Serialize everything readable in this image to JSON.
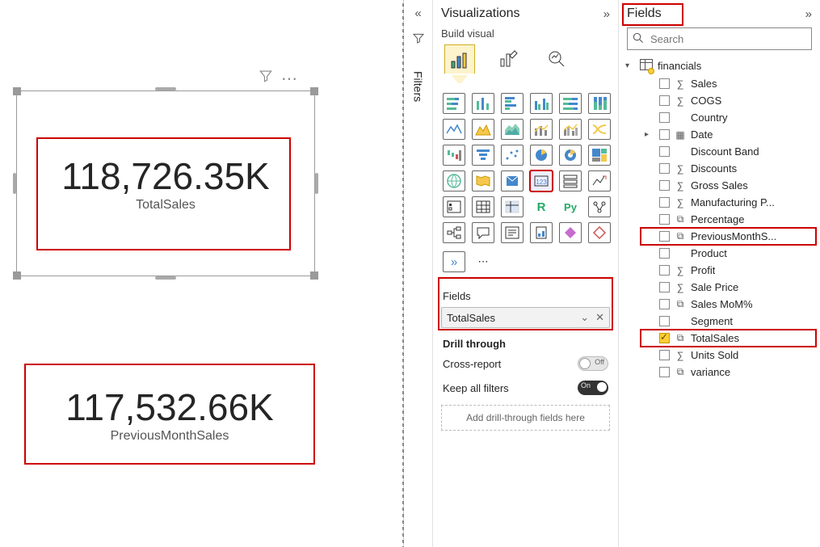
{
  "canvas": {
    "card1_value": "118,726.35K",
    "card1_label": "TotalSales",
    "card2_value": "117,532.66K",
    "card2_label": "PreviousMonthSales"
  },
  "filters_rail": {
    "title": "Filters"
  },
  "vis": {
    "title": "Visualizations",
    "build_label": "Build visual",
    "field_well_label": "Fields",
    "field_value": "TotalSales",
    "drill_title": "Drill through",
    "cross_report": "Cross-report",
    "cross_report_state": "Off",
    "keep_filters": "Keep all filters",
    "keep_filters_state": "On",
    "drill_placeholder": "Add drill-through fields here"
  },
  "fields": {
    "title": "Fields",
    "search_placeholder": "Search",
    "table": "financials",
    "items": [
      {
        "name": "Sales",
        "icon": "sum"
      },
      {
        "name": "COGS",
        "icon": "sum"
      },
      {
        "name": "Country",
        "icon": ""
      },
      {
        "name": "Date",
        "icon": "table",
        "expandable": true
      },
      {
        "name": "Discount Band",
        "icon": ""
      },
      {
        "name": "Discounts",
        "icon": "sum"
      },
      {
        "name": "Gross Sales",
        "icon": "sum"
      },
      {
        "name": "Manufacturing P...",
        "icon": "sum"
      },
      {
        "name": "Percentage",
        "icon": "calc"
      },
      {
        "name": "PreviousMonthS...",
        "icon": "calc",
        "highlight": true
      },
      {
        "name": "Product",
        "icon": ""
      },
      {
        "name": "Profit",
        "icon": "sum"
      },
      {
        "name": "Sale Price",
        "icon": "sum"
      },
      {
        "name": "Sales MoM%",
        "icon": "calc"
      },
      {
        "name": "Segment",
        "icon": ""
      },
      {
        "name": "TotalSales",
        "icon": "calc",
        "checked": true,
        "highlight": true
      },
      {
        "name": "Units Sold",
        "icon": "sum"
      },
      {
        "name": "variance",
        "icon": "calc"
      }
    ]
  }
}
